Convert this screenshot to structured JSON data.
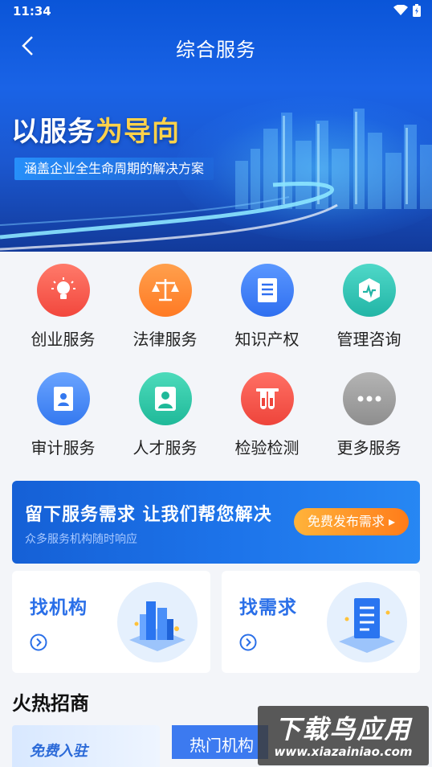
{
  "status_bar": {
    "time": "11:34"
  },
  "header": {
    "title": "综合服务"
  },
  "banner": {
    "slogan_main": "以服务",
    "slogan_highlight": "为导向",
    "subtitle": "涵盖企业全生命周期的解决方案"
  },
  "services": [
    {
      "label": "创业服务",
      "icon": "lightbulb-icon",
      "color": "#f2574b"
    },
    {
      "label": "法律服务",
      "icon": "scales-icon",
      "color": "#ff8a34"
    },
    {
      "label": "知识产权",
      "icon": "document-icon",
      "color": "#3a7ef2"
    },
    {
      "label": "管理咨询",
      "icon": "chart-hexagon-icon",
      "color": "#2fc2b4"
    },
    {
      "label": "审计服务",
      "icon": "audit-icon",
      "color": "#3f88f4"
    },
    {
      "label": "人才服务",
      "icon": "person-icon",
      "color": "#2ec7a6"
    },
    {
      "label": "检验检测",
      "icon": "test-tubes-icon",
      "color": "#f25348"
    },
    {
      "label": "更多服务",
      "icon": "more-icon",
      "color": "#9b9b9b"
    }
  ],
  "promo": {
    "title": "留下服务需求 让我们帮您解决",
    "subtitle": "众多服务机构随时响应",
    "button": "免费发布需求"
  },
  "cards": [
    {
      "title": "找机构",
      "icon": "buildings-icon"
    },
    {
      "title": "找需求",
      "icon": "clipboard-icon"
    }
  ],
  "section": {
    "title": "火热招商"
  },
  "tiles": {
    "first": "免费入驻",
    "second": "热门机构"
  },
  "watermark": {
    "line1": "下载鸟应用",
    "line2": "www.xiazainiao.com"
  },
  "colors": {
    "accent": "#2a6fe8",
    "header_blue": "#1a63e6",
    "promo_button": "#ff8a2a"
  }
}
